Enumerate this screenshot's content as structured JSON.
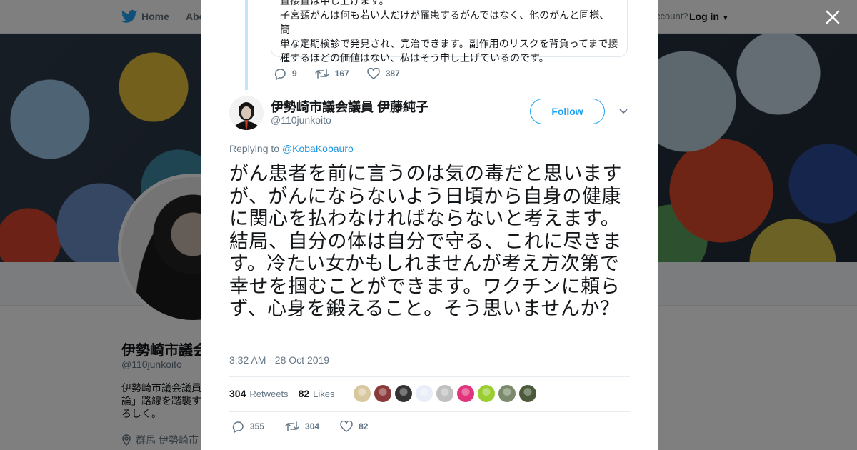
{
  "background": {
    "topbar": {
      "home_label": "Home",
      "about_label": "Abo",
      "account_text": "ccount?",
      "login_label": "Log in"
    },
    "profile": {
      "name": "伊勢崎市議会",
      "handle": "@110junkoito",
      "bio_lines": [
        "伊勢崎市議会議員",
        "論」路線を踏襲す",
        "ろしく。"
      ],
      "location": "群馬 伊勢崎市"
    }
  },
  "modal": {
    "previous_tweet": {
      "text_lines": [
        "直接直は申し上げます。",
        "子宮頸がんは何も若い人だけが罹患するがんではなく、他のがんと同様、簡",
        "単な定期検診で発見され、完治できます。副作用のリスクを背負ってまで接",
        "種するほどの価値はない、私はそう申し上げているのです。"
      ],
      "reply_count": "9",
      "retweet_count": "167",
      "like_count": "387"
    },
    "tweet": {
      "author_name": "伊勢崎市議会議員 伊藤純子",
      "author_handle": "@110junkoito",
      "follow_label": "Follow",
      "replying_prefix": "Replying to",
      "replying_to": "@KobaKobauro",
      "text": "がん患者を前に言うのは気の毒だと思いますが、がんにならないよう日頃から自身の健康に関心を払わなければならないと考えます。結局、自分の体は自分で守る、これに尽きます。冷たい女かもしれませんが考え方次第で幸せを掴むことができます。ワクチンに頼らず、心身を鍛えること。そう思いませんか？",
      "timestamp": "3:32 AM - 28 Oct 2019",
      "retweets_num": "304",
      "retweets_label": "Retweets",
      "likes_num": "82",
      "likes_label": "Likes",
      "reply_count": "355",
      "retweet_count": "304",
      "like_count": "82"
    },
    "likers_colors": [
      "#d9c7a0",
      "#8a3a3a",
      "#333333",
      "#e8eef7",
      "#bfbfbf",
      "#e0357a",
      "#9acd32",
      "#7a8a6a",
      "#4a5a3a"
    ]
  },
  "icons": {
    "close": "close-icon",
    "reply": "reply-icon",
    "retweet": "retweet-icon",
    "like": "heart-icon",
    "caret": "chevron-down-icon",
    "bird": "twitter-bird-icon",
    "location": "location-pin-icon"
  },
  "colors": {
    "accent": "#1da1f2",
    "link": "#1b95e0",
    "text": "#14171a",
    "muted": "#657786"
  }
}
